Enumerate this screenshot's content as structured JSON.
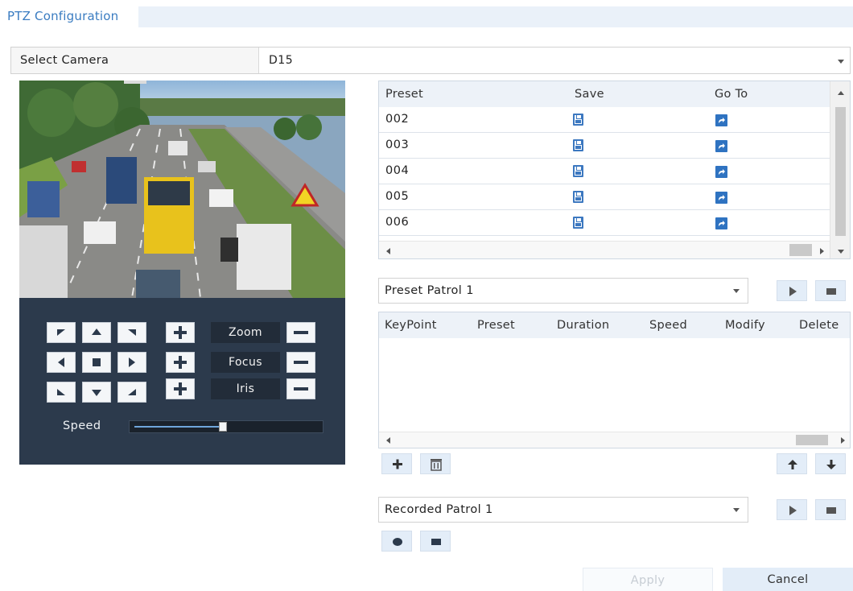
{
  "tabs": [
    "PTZ Configuration"
  ],
  "camera": {
    "label": "Select Camera",
    "value": "D15"
  },
  "ptz": {
    "zoom_label": "Zoom",
    "focus_label": "Focus",
    "iris_label": "Iris",
    "speed_label": "Speed",
    "speed_level": 0.48
  },
  "presets": {
    "headers": {
      "preset": "Preset",
      "save": "Save",
      "goto": "Go To"
    },
    "rows": [
      "002",
      "003",
      "004",
      "005",
      "006"
    ]
  },
  "preset_patrol": {
    "selected": "Preset Patrol 1",
    "headers": {
      "keypoint": "KeyPoint",
      "preset": "Preset",
      "duration": "Duration",
      "speed": "Speed",
      "modify": "Modify",
      "delete": "Delete"
    },
    "rows": []
  },
  "recorded_patrol": {
    "selected": "Recorded Patrol 1"
  },
  "footer": {
    "apply": "Apply",
    "cancel": "Cancel"
  },
  "icons": {
    "save": "save-icon",
    "goto": "goto-icon",
    "play": "play-icon",
    "stop": "stop-icon",
    "add": "add-icon",
    "delete": "trash-icon",
    "up": "arrow-up-icon",
    "down": "arrow-down-icon",
    "record": "record-icon"
  },
  "colors": {
    "accent": "#3a7cc1",
    "ptz_panel": "#2c3a4c",
    "goto_blue": "#2f73c1"
  }
}
